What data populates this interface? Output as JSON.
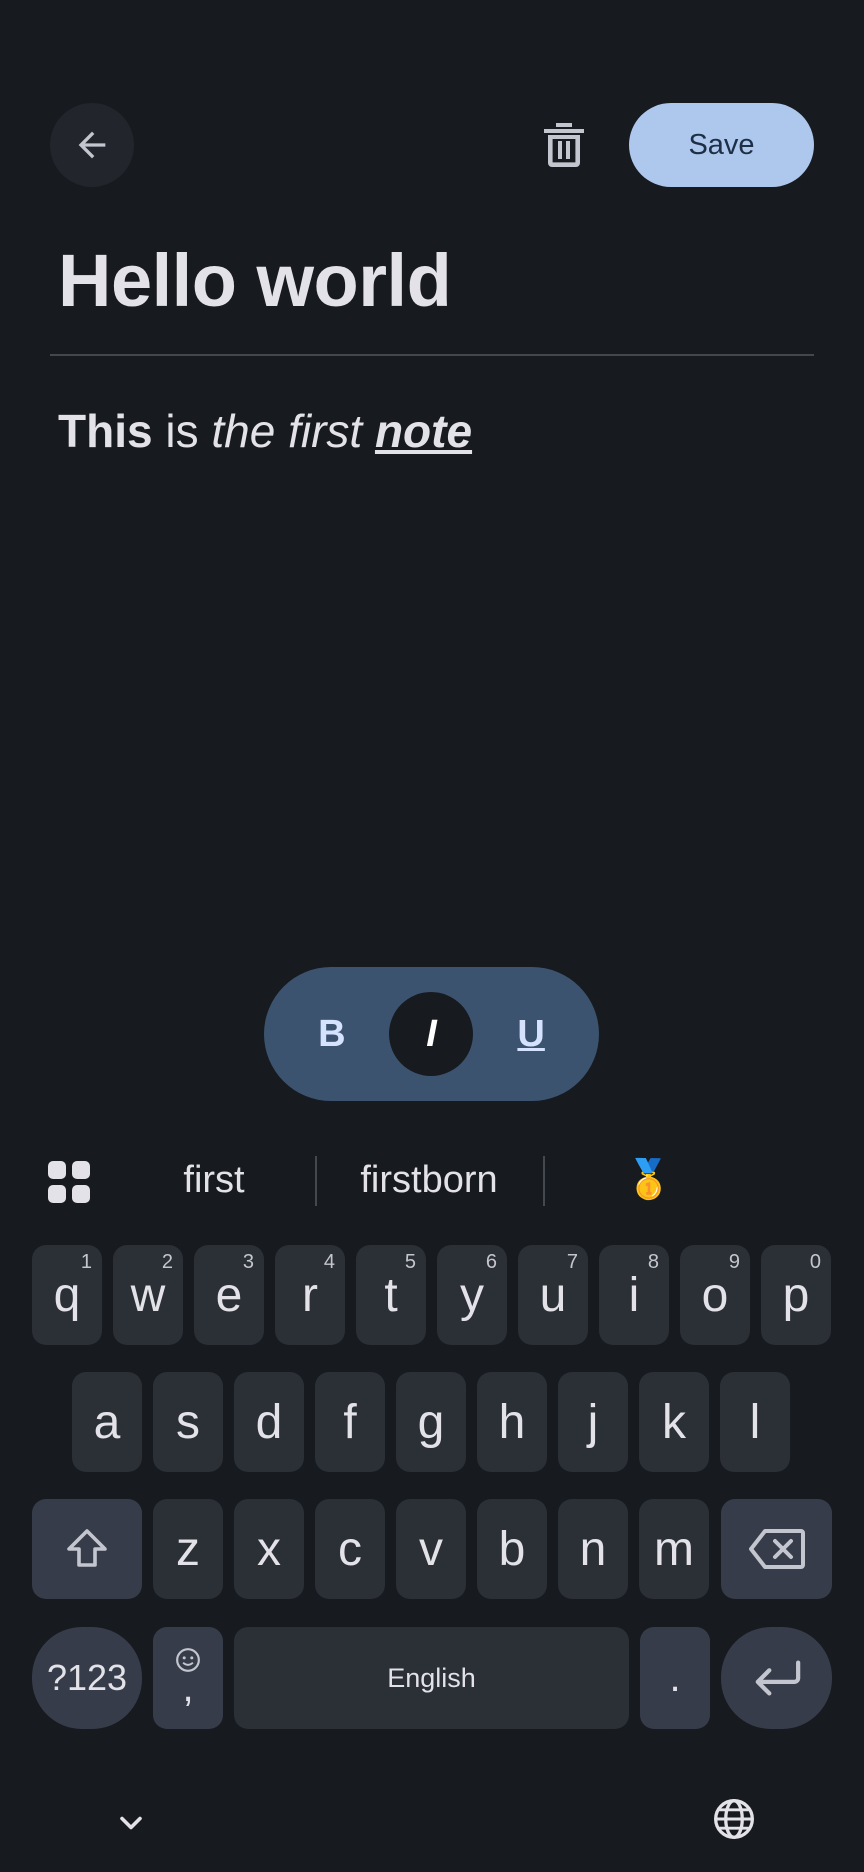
{
  "app_bar": {
    "back_icon": "arrow-back-icon",
    "delete_icon": "trash-icon",
    "save_label": "Save"
  },
  "note": {
    "title": "Hello world",
    "body": {
      "w1": "This",
      "w2": " is ",
      "w3": "the first",
      "w4": " ",
      "w5": "note"
    }
  },
  "format_bar": {
    "bold": "B",
    "italic": "I",
    "underline": "U",
    "active": "italic"
  },
  "suggestions": {
    "items": [
      "first",
      "firstborn",
      "🥇"
    ]
  },
  "keyboard": {
    "row1": [
      {
        "key": "q",
        "hint": "1"
      },
      {
        "key": "w",
        "hint": "2"
      },
      {
        "key": "e",
        "hint": "3"
      },
      {
        "key": "r",
        "hint": "4"
      },
      {
        "key": "t",
        "hint": "5"
      },
      {
        "key": "y",
        "hint": "6"
      },
      {
        "key": "u",
        "hint": "7"
      },
      {
        "key": "i",
        "hint": "8"
      },
      {
        "key": "o",
        "hint": "9"
      },
      {
        "key": "p",
        "hint": "0"
      }
    ],
    "row2": [
      "a",
      "s",
      "d",
      "f",
      "g",
      "h",
      "j",
      "k",
      "l"
    ],
    "row3": [
      "z",
      "x",
      "c",
      "v",
      "b",
      "n",
      "m"
    ],
    "symbols_label": "?123",
    "comma_label": ",",
    "space_label": "English",
    "period_label": "."
  },
  "colors": {
    "background": "#171a1f",
    "save_button": "#adc7ed",
    "format_bar": "#3c5370",
    "key": "#2b2f36",
    "func_key": "#363c4a"
  }
}
